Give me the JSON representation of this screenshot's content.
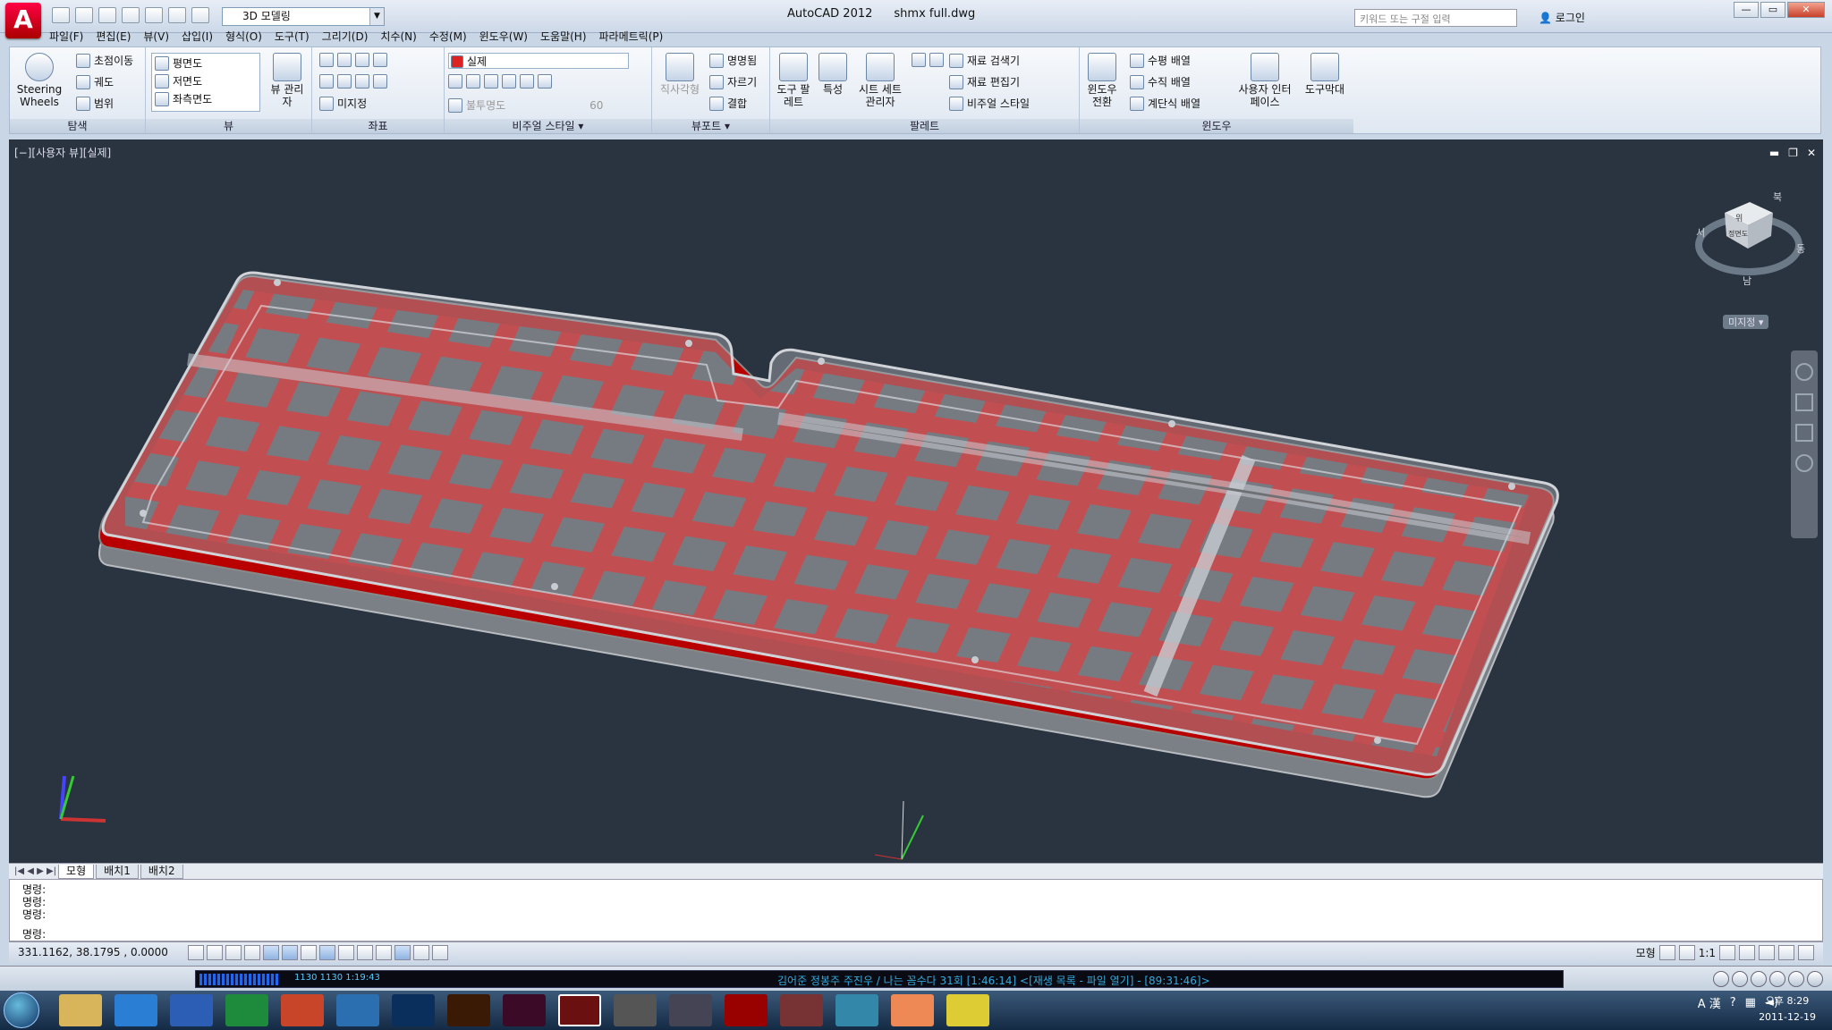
{
  "titlebar": {
    "logo": "A",
    "workspace": "3D 모델링",
    "app_name": "AutoCAD 2012",
    "file_name": "shmx full.dwg",
    "search_placeholder": "키워드 또는 구절 입력",
    "login": "로그인"
  },
  "menus": [
    "파일(F)",
    "편집(E)",
    "뷰(V)",
    "삽입(I)",
    "형식(O)",
    "도구(T)",
    "그리기(D)",
    "치수(N)",
    "수정(M)",
    "윈도우(W)",
    "도움말(H)",
    "파라메트릭(P)"
  ],
  "ribbon": {
    "nav": {
      "title": "탐색",
      "steering": "Steering Wheels",
      "pan": "초점이동",
      "orbit": "궤도",
      "extents": "범위"
    },
    "views": {
      "title": "뷰",
      "items": [
        "평면도",
        "저면도",
        "좌측면도"
      ],
      "manager": "뷰 관리자"
    },
    "coords": {
      "title": "좌표",
      "world": "미지정"
    },
    "visual": {
      "title": "비주얼 스타일",
      "style": "실제",
      "opacity_label": "불투명도",
      "opacity_value": "60"
    },
    "viewports": {
      "title": "뷰포트",
      "rect": "직사각형",
      "named": "명명됨",
      "clip": "자르기",
      "join": "결합"
    },
    "palettes": {
      "title": "팔레트",
      "tool": "도구 팔레트",
      "props": "특성",
      "sheetset": "시트 세트 관리자",
      "material_browser": "재료 검색기",
      "material_editor": "재료 편집기",
      "vstyles": "비주얼 스타일"
    },
    "window": {
      "title": "윈도우",
      "switch": "윈도우 전환",
      "htile": "수평 배열",
      "vtile": "수직 배열",
      "cascade": "계단식 배열",
      "ui": "사용자 인터페이스",
      "toolbars": "도구막대"
    }
  },
  "viewport": {
    "label": "[−][사용자 뷰][실제]",
    "viewcube_top": "위",
    "viewcube_front": "정면도",
    "viewcube_compass_n": "북",
    "viewcube_compass_e": "동",
    "viewcube_compass_s": "남",
    "viewcube_compass_w": "서",
    "ucs_label": "미지정"
  },
  "layout_tabs": [
    "모형",
    "배치1",
    "배치2"
  ],
  "command": {
    "prompt": "명령:",
    "lines": [
      "명령:",
      "명령:",
      "명령:"
    ]
  },
  "status": {
    "coords": "331.1162, 38.1795 , 0.0000",
    "model": "모형",
    "scale": "1:1"
  },
  "media": {
    "now_playing": "김어준 정봉주 주진우 / 나는 꼼수다 31회  [1:46:14]   <[재생 목록 - 파일 열기] - [89:31:46]>",
    "time": "1130  1130   1:19:43"
  },
  "taskbar": {
    "time": "오후 8:29",
    "date": "2011-12-19",
    "tray_lang": "A 漢"
  },
  "colors": {
    "plate": "#d40000",
    "case": "#8a9096",
    "viewport_bg": "#2a3340"
  }
}
